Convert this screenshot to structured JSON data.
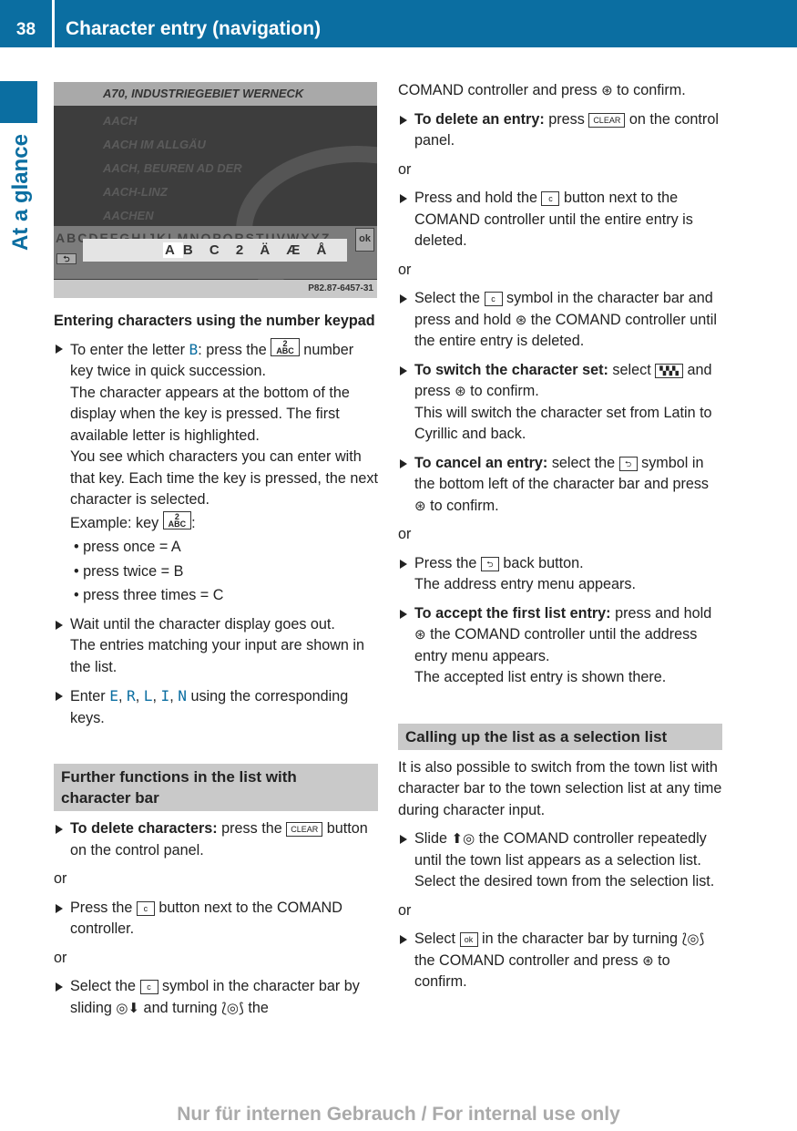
{
  "header": {
    "page_number": "38",
    "title": "Character entry (navigation)"
  },
  "side_tab": {
    "label": "At a glance",
    "color": "#0b6ea1"
  },
  "screenshot": {
    "title": "A70, INDUSTRIEGEBIET WERNECK",
    "list": [
      "AACH",
      "AACH IM ALLGÄU",
      "AACH, BEUREN AD DER",
      "AACH-LINZ",
      "AACHEN"
    ],
    "character_bar": "ABCDEFGHIJKLMNOPQRSTUVWXYZ",
    "ok_label": "ok",
    "back_label": "⮌",
    "popup_selected": "A",
    "popup_rest": "B C 2 Ä Æ Å",
    "code": "P82.87-6457-31"
  },
  "left": [
    {
      "type": "h",
      "text": "Entering characters using the number keypad"
    },
    {
      "type": "step",
      "parts": [
        "To enter the letter ",
        {
          "hl": "B"
        },
        ": press the ",
        {
          "icon": "key-2-icon",
          "label": "2\nABC"
        },
        " number key twice in quick succession."
      ],
      "notes": [
        "The character appears at the bottom of the display when the key is pressed. The first available letter is highlighted.",
        "You see which characters you can enter with that key. Each time the key is pressed, the next character is selected.",
        {
          "parts": [
            "Example: key ",
            {
              "icon": "key-2-icon",
              "label": "2\nABC"
            },
            ":"
          ]
        }
      ],
      "bullets": [
        "press once = A",
        "press twice = B",
        "press three times = C"
      ]
    },
    {
      "type": "step",
      "parts": [
        "Wait until the character display goes out."
      ],
      "notes": [
        "The entries matching your input are shown in the list."
      ]
    },
    {
      "type": "step",
      "parts": [
        "Enter ",
        {
          "hl": "E"
        },
        ", ",
        {
          "hl": "R"
        },
        ", ",
        {
          "hl": "L"
        },
        ", ",
        {
          "hl": "I"
        },
        ", ",
        {
          "hl": "N"
        },
        " using the corresponding keys."
      ]
    },
    {
      "type": "section",
      "text": "Further functions in the list with character bar"
    },
    {
      "type": "step",
      "parts": [
        {
          "b": "To delete characters:"
        },
        " press the ",
        {
          "icon": "clear-button-icon",
          "label": "CLEAR"
        },
        " button on the control panel."
      ]
    },
    {
      "type": "or",
      "text": "or"
    },
    {
      "type": "step",
      "parts": [
        "Press the ",
        {
          "icon": "c-button-icon",
          "label": "c"
        },
        " button next to the COMAND controller."
      ]
    },
    {
      "type": "or",
      "text": "or"
    },
    {
      "type": "step",
      "parts": [
        "Select the ",
        {
          "icon": "c-symbol-icon",
          "label": "c"
        },
        " symbol in the character bar by sliding ",
        {
          "glyph": "slide-down-icon",
          "label": "◎⬇"
        },
        " and turning ",
        {
          "glyph": "turn-icon",
          "label": "⟅◎⟆"
        },
        " the"
      ]
    }
  ],
  "right": [
    {
      "type": "plain",
      "parts": [
        "COMAND controller and press ",
        {
          "glyph": "press-icon",
          "label": "⊛"
        },
        " to confirm."
      ]
    },
    {
      "type": "step",
      "parts": [
        {
          "b": "To delete an entry:"
        },
        " press ",
        {
          "icon": "clear-button-icon",
          "label": "CLEAR"
        },
        " on the control panel."
      ]
    },
    {
      "type": "or",
      "text": "or"
    },
    {
      "type": "step",
      "parts": [
        "Press and hold the ",
        {
          "icon": "c-button-icon",
          "label": "c"
        },
        " button next to the COMAND controller until the entire entry is deleted."
      ]
    },
    {
      "type": "or",
      "text": "or"
    },
    {
      "type": "step",
      "parts": [
        "Select the ",
        {
          "icon": "c-symbol-icon",
          "label": "c"
        },
        " symbol in the character bar and press and hold ",
        {
          "glyph": "press-icon",
          "label": "⊛"
        },
        " the COMAND controller until the entire entry is deleted."
      ]
    },
    {
      "type": "step",
      "parts": [
        {
          "b": "To switch the character set:"
        },
        " select ",
        {
          "icon": "character-set-icon",
          "label": "▚▚▚"
        },
        " and press ",
        {
          "glyph": "press-icon",
          "label": "⊛"
        },
        " to confirm."
      ],
      "notes": [
        "This will switch the character set from Latin to Cyrillic and back."
      ]
    },
    {
      "type": "step",
      "parts": [
        {
          "b": "To cancel an entry:"
        },
        " select the ",
        {
          "icon": "cancel-symbol-icon",
          "label": "⮌"
        },
        " symbol in the bottom left of the character bar and press ",
        {
          "glyph": "press-icon",
          "label": "⊛"
        },
        " to confirm."
      ]
    },
    {
      "type": "or",
      "text": "or"
    },
    {
      "type": "step",
      "parts": [
        "Press the ",
        {
          "icon": "back-button-icon",
          "label": "⮌"
        },
        " back button."
      ],
      "notes": [
        "The address entry menu appears."
      ]
    },
    {
      "type": "step",
      "parts": [
        {
          "b": "To accept the first list entry:"
        },
        " press and hold ",
        {
          "glyph": "press-icon",
          "label": "⊛"
        },
        " the COMAND controller until the address entry menu appears."
      ],
      "notes": [
        "The accepted list entry is shown there."
      ]
    },
    {
      "type": "section",
      "text": "Calling up the list as a selection list"
    },
    {
      "type": "plain",
      "parts": [
        "It is also possible to switch from the town list with character bar to the town selection list at any time during character input."
      ]
    },
    {
      "type": "step",
      "parts": [
        "Slide ",
        {
          "glyph": "slide-up-icon",
          "label": "⬆◎"
        },
        " the COMAND controller repeatedly until the town list appears as a selection list."
      ],
      "notes": [
        "Select the desired town from the selection list."
      ]
    },
    {
      "type": "or",
      "text": "or"
    },
    {
      "type": "step",
      "parts": [
        "Select ",
        {
          "icon": "ok-icon",
          "label": "ok"
        },
        " in the character bar by turning ",
        {
          "glyph": "turn-icon",
          "label": "⟅◎⟆"
        },
        " the COMAND controller and press ",
        {
          "glyph": "press-icon",
          "label": "⊛"
        },
        " to confirm."
      ]
    }
  ],
  "watermark": "Nur für internen Gebrauch / For internal use only"
}
